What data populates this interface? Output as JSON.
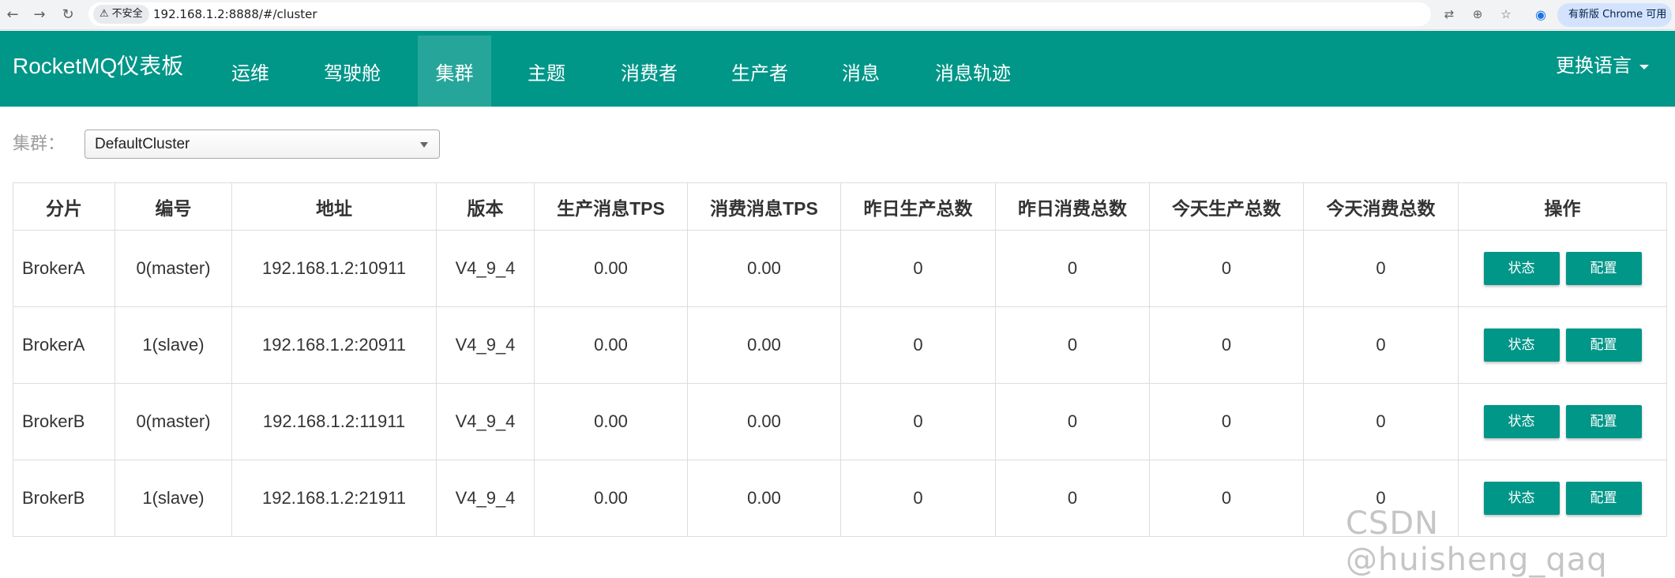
{
  "browser": {
    "back_icon": "←",
    "forward_icon": "→",
    "reload_icon": "↻",
    "security_label": "不安全",
    "url": "192.168.1.2:8888/#/cluster",
    "update_label": "有新版 Chrome 可用"
  },
  "navbar": {
    "brand": "RocketMQ仪表板",
    "items": [
      {
        "label": "运维"
      },
      {
        "label": "驾驶舱"
      },
      {
        "label": "集群"
      },
      {
        "label": "主题"
      },
      {
        "label": "消费者"
      },
      {
        "label": "生产者"
      },
      {
        "label": "消息"
      },
      {
        "label": "消息轨迹"
      }
    ],
    "active_index": 2,
    "language_label": "更换语言",
    "accent_color": "#009688"
  },
  "cluster_filter": {
    "label": "集群：",
    "selected": "DefaultCluster"
  },
  "table": {
    "headers": [
      "分片",
      "编号",
      "地址",
      "版本",
      "生产消息TPS",
      "消费消息TPS",
      "昨日生产总数",
      "昨日消费总数",
      "今天生产总数",
      "今天消费总数",
      "操作"
    ],
    "rows": [
      {
        "shard": "BrokerA",
        "id": "0(master)",
        "address": "192.168.1.2:10911",
        "version": "V4_9_4",
        "produce_tps": "0.00",
        "consume_tps": "0.00",
        "yesterday_produce": "0",
        "yesterday_consume": "0",
        "today_produce": "0",
        "today_consume": "0"
      },
      {
        "shard": "BrokerA",
        "id": "1(slave)",
        "address": "192.168.1.2:20911",
        "version": "V4_9_4",
        "produce_tps": "0.00",
        "consume_tps": "0.00",
        "yesterday_produce": "0",
        "yesterday_consume": "0",
        "today_produce": "0",
        "today_consume": "0"
      },
      {
        "shard": "BrokerB",
        "id": "0(master)",
        "address": "192.168.1.2:11911",
        "version": "V4_9_4",
        "produce_tps": "0.00",
        "consume_tps": "0.00",
        "yesterday_produce": "0",
        "yesterday_consume": "0",
        "today_produce": "0",
        "today_consume": "0"
      },
      {
        "shard": "BrokerB",
        "id": "1(slave)",
        "address": "192.168.1.2:21911",
        "version": "V4_9_4",
        "produce_tps": "0.00",
        "consume_tps": "0.00",
        "yesterday_produce": "0",
        "yesterday_consume": "0",
        "today_produce": "0",
        "today_consume": "0"
      }
    ],
    "status_button": "状态",
    "config_button": "配置"
  },
  "watermark": "CSDN @huisheng_qaq"
}
